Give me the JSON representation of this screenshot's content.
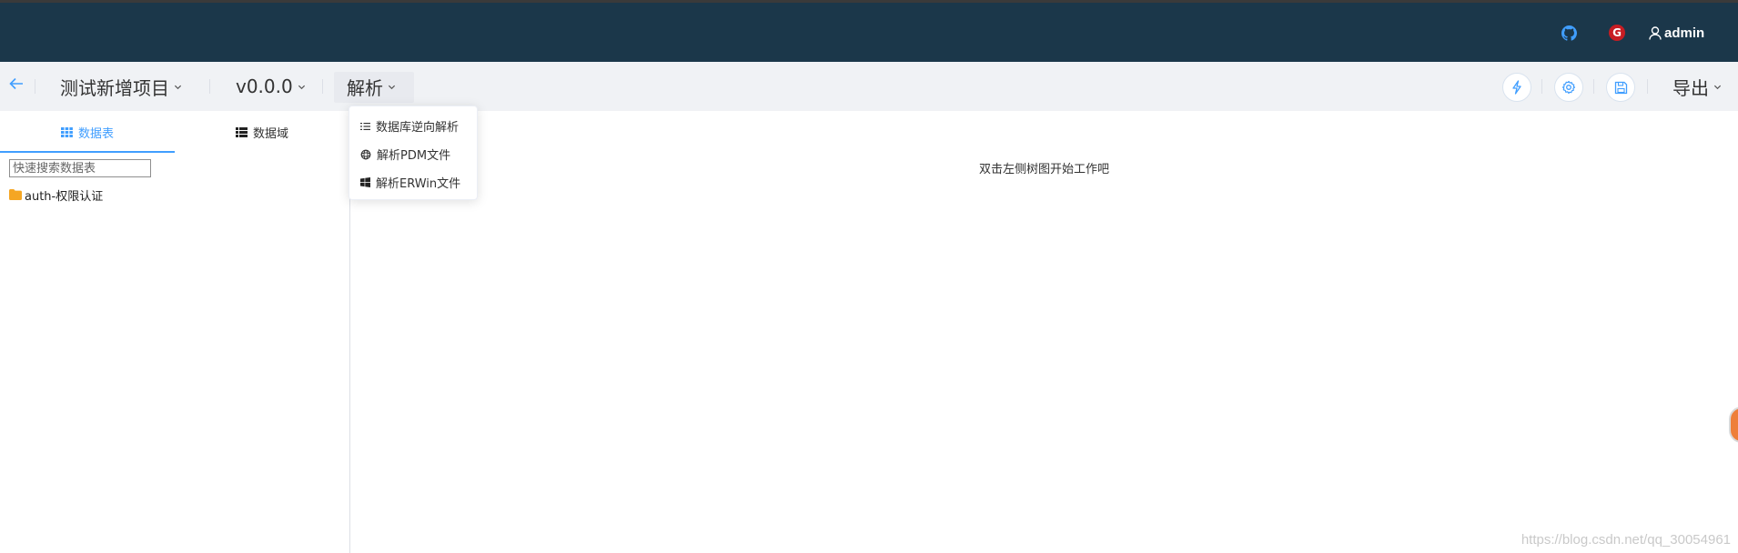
{
  "header": {
    "user": "admin",
    "icons": {
      "github": "github-icon",
      "gitee": "gitee-icon",
      "user": "user-icon"
    },
    "gitee_letter": "G"
  },
  "toolbar": {
    "project": "测试新增项目",
    "version": "v0.0.0",
    "parse": "解析",
    "export": "导出",
    "icons": [
      "back-arrow-icon",
      "flash-icon",
      "gear-icon",
      "save-icon"
    ]
  },
  "parse_menu": {
    "items": [
      {
        "label": "数据库逆向解析",
        "icon": "list-order-icon"
      },
      {
        "label": "解析PDM文件",
        "icon": "pdm-icon"
      },
      {
        "label": "解析ERWin文件",
        "icon": "windows-icon"
      }
    ]
  },
  "sidebar": {
    "tabs": [
      {
        "label": "数据表",
        "icon": "grid-icon",
        "active": true
      },
      {
        "label": "数据域",
        "icon": "list-icon",
        "active": false
      }
    ],
    "search_placeholder": "快速搜索数据表",
    "tree": [
      {
        "label": "auth-权限认证",
        "icon": "folder-icon"
      }
    ]
  },
  "main": {
    "empty_message": "双击左侧树图开始工作吧"
  },
  "watermark": "https://blog.csdn.net/qq_30054961",
  "colors": {
    "header_bg": "#1b374a",
    "toolbar_bg": "#f0f2f5",
    "accent": "#409eff",
    "folder": "#f5a623"
  }
}
